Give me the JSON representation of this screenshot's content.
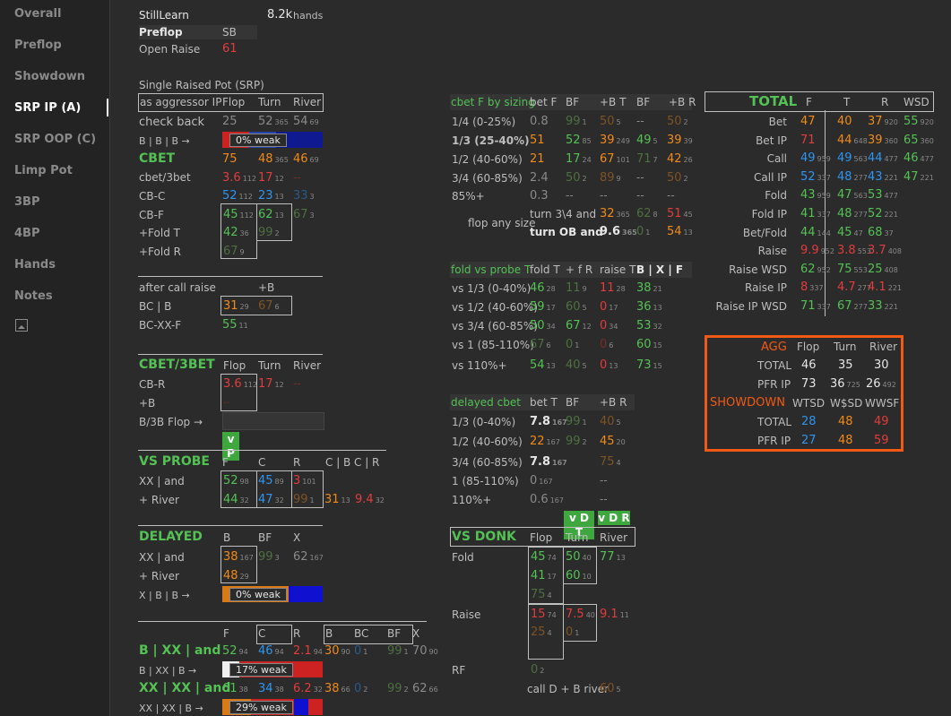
{
  "nav": {
    "items": [
      "Overall",
      "Preflop",
      "Showdown",
      "SRP IP (A)",
      "SRP OOP (C)",
      "Limp Pot",
      "3BP",
      "4BP",
      "Hands",
      "Notes"
    ],
    "icon": "image-icon",
    "active": "SRP IP (A)"
  },
  "player": {
    "name": "StillLearn",
    "hands": "8.2k",
    "hands_label": "hands"
  },
  "preflop": {
    "title": "Preflop",
    "pos": "SB",
    "row_label": "Open Raise",
    "value": "61"
  },
  "srp": {
    "title": "Single Raised Pot (SRP)",
    "agg_label": "as aggressor IP",
    "cols": [
      "Flop",
      "Turn",
      "River"
    ],
    "check_back": {
      "label": "check back",
      "v": [
        "25",
        "52",
        "54"
      ],
      "s": [
        "",
        "365",
        "69"
      ]
    },
    "bbb": {
      "label": "B | B | B →",
      "pill": "0% weak"
    },
    "cbet": {
      "label": "CBET",
      "v": [
        "75",
        "48",
        "46"
      ],
      "s": [
        "",
        "365",
        "69"
      ]
    },
    "cbet3bet": {
      "label": "cbet/3bet",
      "v": [
        "3.6",
        "17"
      ],
      "s": [
        "112",
        "12"
      ],
      "dash": "--"
    },
    "cbc": {
      "label": "CB-C",
      "v": [
        "52",
        "23",
        "33"
      ],
      "s": [
        "112",
        "13",
        "3"
      ]
    },
    "cbf": {
      "label": "CB-F",
      "v": [
        "45",
        "62",
        "67"
      ],
      "s": [
        "112",
        "13",
        "3"
      ]
    },
    "foldt": {
      "label": "+Fold T",
      "v": [
        "42",
        "99"
      ],
      "s": [
        "36",
        "2"
      ]
    },
    "foldr": {
      "label": "+Fold R",
      "v": [
        "67"
      ],
      "s": [
        "9"
      ]
    }
  },
  "aftercall": {
    "title": "after call raise",
    "col": "+B",
    "bcb": {
      "label": "BC | B",
      "v": [
        "31",
        "67"
      ],
      "s": [
        "29",
        "6"
      ]
    },
    "bcxxf": {
      "label": "BC-XX-F",
      "v": [
        "55"
      ],
      "s": [
        "11"
      ]
    }
  },
  "cbet3": {
    "title": "CBET/3BET",
    "cols": [
      "Flop",
      "Turn",
      "River"
    ],
    "cbr": {
      "label": "CB-R",
      "v": [
        "3.6",
        "17"
      ],
      "s": [
        "112",
        "12"
      ],
      "dash": "--"
    },
    "plusb": {
      "label": "+B",
      "dash": "--"
    },
    "b3b": {
      "label": "B/3B Flop →"
    },
    "tag": "v P"
  },
  "vsprobe": {
    "title": "VS PROBE",
    "cols": [
      "F",
      "C",
      "R",
      "C | B",
      "C | R"
    ],
    "r1": {
      "label": "XX | and",
      "v": [
        "52",
        "45",
        "3"
      ],
      "s": [
        "98",
        "89",
        "101"
      ]
    },
    "r2": {
      "label": "+ River",
      "v": [
        "44",
        "47",
        "99",
        "31",
        "9.4"
      ],
      "s": [
        "32",
        "32",
        "1",
        "13",
        "32"
      ]
    }
  },
  "delayed": {
    "title": "DELAYED",
    "cols": [
      "B",
      "BF",
      "X"
    ],
    "r1": {
      "label": "XX | and",
      "v": [
        "38",
        "99",
        "62"
      ],
      "s": [
        "167",
        "3",
        "167"
      ]
    },
    "r2": {
      "label": "+ River",
      "v": [
        "48"
      ],
      "s": [
        "29"
      ]
    },
    "r3": {
      "label": "X | B | B →",
      "pill": "0% weak"
    }
  },
  "bottom": {
    "cols": [
      "F",
      "C",
      "R",
      "B",
      "BC",
      "BF",
      "X"
    ],
    "r1": {
      "label": "B | XX | and",
      "v": [
        "52",
        "46",
        "2.1",
        "30",
        "0",
        "99",
        "70"
      ],
      "s": [
        "94",
        "94",
        "94",
        "90",
        "1",
        "1",
        "90"
      ]
    },
    "r1b": {
      "label": "B | XX | B →",
      "pill": "17% weak"
    },
    "r2": {
      "label": "XX | XX | and",
      "v": [
        "61",
        "34",
        "6.2",
        "38",
        "0",
        "99",
        "62"
      ],
      "s": [
        "38",
        "38",
        "32",
        "66",
        "2",
        "2",
        "66"
      ]
    },
    "r2b": {
      "label": "XX | XX | B →",
      "pill": "29% weak"
    }
  },
  "sizing": {
    "title": "cbet F by sizing",
    "cols": [
      "bet F",
      "BF",
      "+B T",
      "BF",
      "+B R"
    ],
    "rows": [
      {
        "label": "1/4 (0-25%)",
        "v": [
          "0.8",
          "99",
          "50",
          "--",
          "50"
        ],
        "s": [
          "",
          "1",
          "5",
          "",
          "2"
        ]
      },
      {
        "label": "1/3 (25-40%)",
        "v": [
          "51",
          "52",
          "39",
          "49",
          "39"
        ],
        "s": [
          "",
          "85",
          "249",
          "5",
          "39"
        ]
      },
      {
        "label": "1/2 (40-60%)",
        "v": [
          "21",
          "17",
          "67",
          "71",
          "42"
        ],
        "s": [
          "",
          "24",
          "101",
          "7",
          "26"
        ]
      },
      {
        "label": "3/4 (60-85%)",
        "v": [
          "2.4",
          "50",
          "89",
          "--",
          "50"
        ],
        "s": [
          "",
          "2",
          "9",
          "",
          "2"
        ]
      },
      {
        "label": "85%+",
        "v": [
          "0.3",
          "--",
          "--",
          "--",
          "--"
        ],
        "s": [
          "",
          "",
          "",
          "",
          ""
        ]
      }
    ],
    "any": {
      "label": "flop any size",
      "t1": "turn 3\\4 and",
      "t2": "turn OB and",
      "v": [
        "32",
        "62",
        "51",
        "9.6",
        "0",
        "54"
      ],
      "s": [
        "365",
        "8",
        "45",
        "365",
        "1",
        "13"
      ]
    }
  },
  "foldprobe": {
    "title": "fold vs probe T",
    "cols": [
      "fold T",
      "+ f R",
      "raise T",
      "B | X | F"
    ],
    "rows": [
      {
        "label": "vs 1/3 (0-40%)",
        "v": [
          "46",
          "11",
          "11",
          "38"
        ],
        "s": [
          "28",
          "9",
          "28",
          "21"
        ]
      },
      {
        "label": "vs 1/2 (40-60%)",
        "v": [
          "59",
          "60",
          "0",
          "36"
        ],
        "s": [
          "17",
          "5",
          "17",
          "13"
        ]
      },
      {
        "label": "vs 3/4 (60-85%)",
        "v": [
          "50",
          "67",
          "0",
          "53"
        ],
        "s": [
          "34",
          "12",
          "34",
          "32"
        ]
      },
      {
        "label": "vs 1 (85-110%)",
        "v": [
          "67",
          "0",
          "0",
          "60"
        ],
        "s": [
          "6",
          "1",
          "6",
          "15"
        ]
      },
      {
        "label": "vs 110%+",
        "v": [
          "54",
          "40",
          "0",
          "73"
        ],
        "s": [
          "13",
          "5",
          "13",
          "15"
        ]
      }
    ]
  },
  "delayedcbet": {
    "title": "delayed cbet",
    "cols": [
      "bet T",
      "BF",
      "+B R"
    ],
    "rows": [
      {
        "label": "1/3 (0-40%)",
        "v": [
          "7.8",
          "99",
          "40"
        ],
        "s": [
          "167",
          "1",
          "5"
        ]
      },
      {
        "label": "1/2 (40-60%)",
        "v": [
          "22",
          "99",
          "45"
        ],
        "s": [
          "167",
          "2",
          "20"
        ]
      },
      {
        "label": "3/4 (60-85%)",
        "v": [
          "7.8",
          "75"
        ],
        "s": [
          "167",
          "4"
        ]
      },
      {
        "label": "1 (85-110%)",
        "v": [
          "0",
          "--"
        ],
        "s": [
          "167",
          ""
        ]
      },
      {
        "label": "110%+",
        "v": [
          "0.6",
          "--"
        ],
        "s": [
          "167",
          ""
        ]
      }
    ],
    "tags": [
      "v D T",
      "v D R"
    ]
  },
  "vsdonk": {
    "title": "VS DONK",
    "cols": [
      "Flop",
      "Turn",
      "River"
    ],
    "fold": {
      "label": "Fold",
      "v": [
        "45",
        "50",
        "77",
        "41",
        "60",
        "75"
      ],
      "s": [
        "74",
        "40",
        "13",
        "17",
        "10",
        "4"
      ]
    },
    "raise": {
      "label": "Raise",
      "v": [
        "15",
        "7.5",
        "9.1",
        "25",
        "0"
      ],
      "s": [
        "74",
        "40",
        "11",
        "4",
        "1"
      ]
    },
    "rf": {
      "label": "RF",
      "v": "0",
      "s": "2"
    },
    "calld": {
      "label": "call D + B river",
      "v": "60",
      "s": "5"
    }
  },
  "total": {
    "title": "TOTAL",
    "cols": [
      "F",
      "T",
      "R",
      "WSD"
    ],
    "rows": [
      {
        "label": "Bet",
        "v": [
          "47",
          "40",
          "37",
          "55"
        ],
        "s": [
          "",
          "",
          "920",
          "920"
        ]
      },
      {
        "label": "Bet IP",
        "v": [
          "71",
          "44",
          "39",
          "65"
        ],
        "s": [
          "",
          "648",
          "360",
          "360"
        ]
      },
      {
        "label": "Call",
        "v": [
          "49",
          "49",
          "44",
          "46"
        ],
        "s": [
          "959",
          "563",
          "477",
          "477"
        ]
      },
      {
        "label": "Call IP",
        "v": [
          "52",
          "48",
          "43",
          "47"
        ],
        "s": [
          "337",
          "277",
          "221",
          "221"
        ]
      },
      {
        "label": "Fold",
        "v": [
          "43",
          "47",
          "53"
        ],
        "s": [
          "959",
          "563",
          "477"
        ]
      },
      {
        "label": "Fold IP",
        "v": [
          "41",
          "48",
          "52"
        ],
        "s": [
          "337",
          "277",
          "221"
        ]
      },
      {
        "label": "Bet/Fold",
        "v": [
          "44",
          "45",
          "68"
        ],
        "s": [
          "144",
          "47",
          "37"
        ]
      },
      {
        "label": "Raise",
        "v": [
          "9.9",
          "3.8",
          "3.7"
        ],
        "s": [
          "952",
          "553",
          "408"
        ]
      },
      {
        "label": "Raise WSD",
        "v": [
          "62",
          "75",
          "25"
        ],
        "s": [
          "952",
          "553",
          "408"
        ]
      },
      {
        "label": "Raise IP",
        "v": [
          "8",
          "4.7",
          "4.1"
        ],
        "s": [
          "337",
          "277",
          "221"
        ]
      },
      {
        "label": "Raise IP WSD",
        "v": [
          "71",
          "67",
          "33"
        ],
        "s": [
          "337",
          "277",
          "221"
        ]
      }
    ]
  },
  "agg": {
    "title": "AGG",
    "cols": [
      "Flop",
      "Turn",
      "River"
    ],
    "total": {
      "label": "TOTAL",
      "v": [
        "46",
        "35",
        "30"
      ]
    },
    "pfrip": {
      "label": "PFR IP",
      "v": [
        "73",
        "36",
        "26"
      ],
      "s": [
        "",
        "725",
        "492"
      ]
    },
    "sd_title": "SHOWDOWN",
    "sd_cols": [
      "WTSD",
      "W$SD",
      "WWSF"
    ],
    "sd_total": {
      "label": "TOTAL",
      "v": [
        "28",
        "48",
        "49"
      ]
    },
    "sd_pfrip": {
      "label": "PFR IP",
      "v": [
        "27",
        "48",
        "59"
      ]
    }
  },
  "colors": {
    "green": "#54c154",
    "orange": "#f08a18",
    "red": "#e23c3c",
    "blue": "#2e95f0",
    "accent": "#f05a14"
  }
}
